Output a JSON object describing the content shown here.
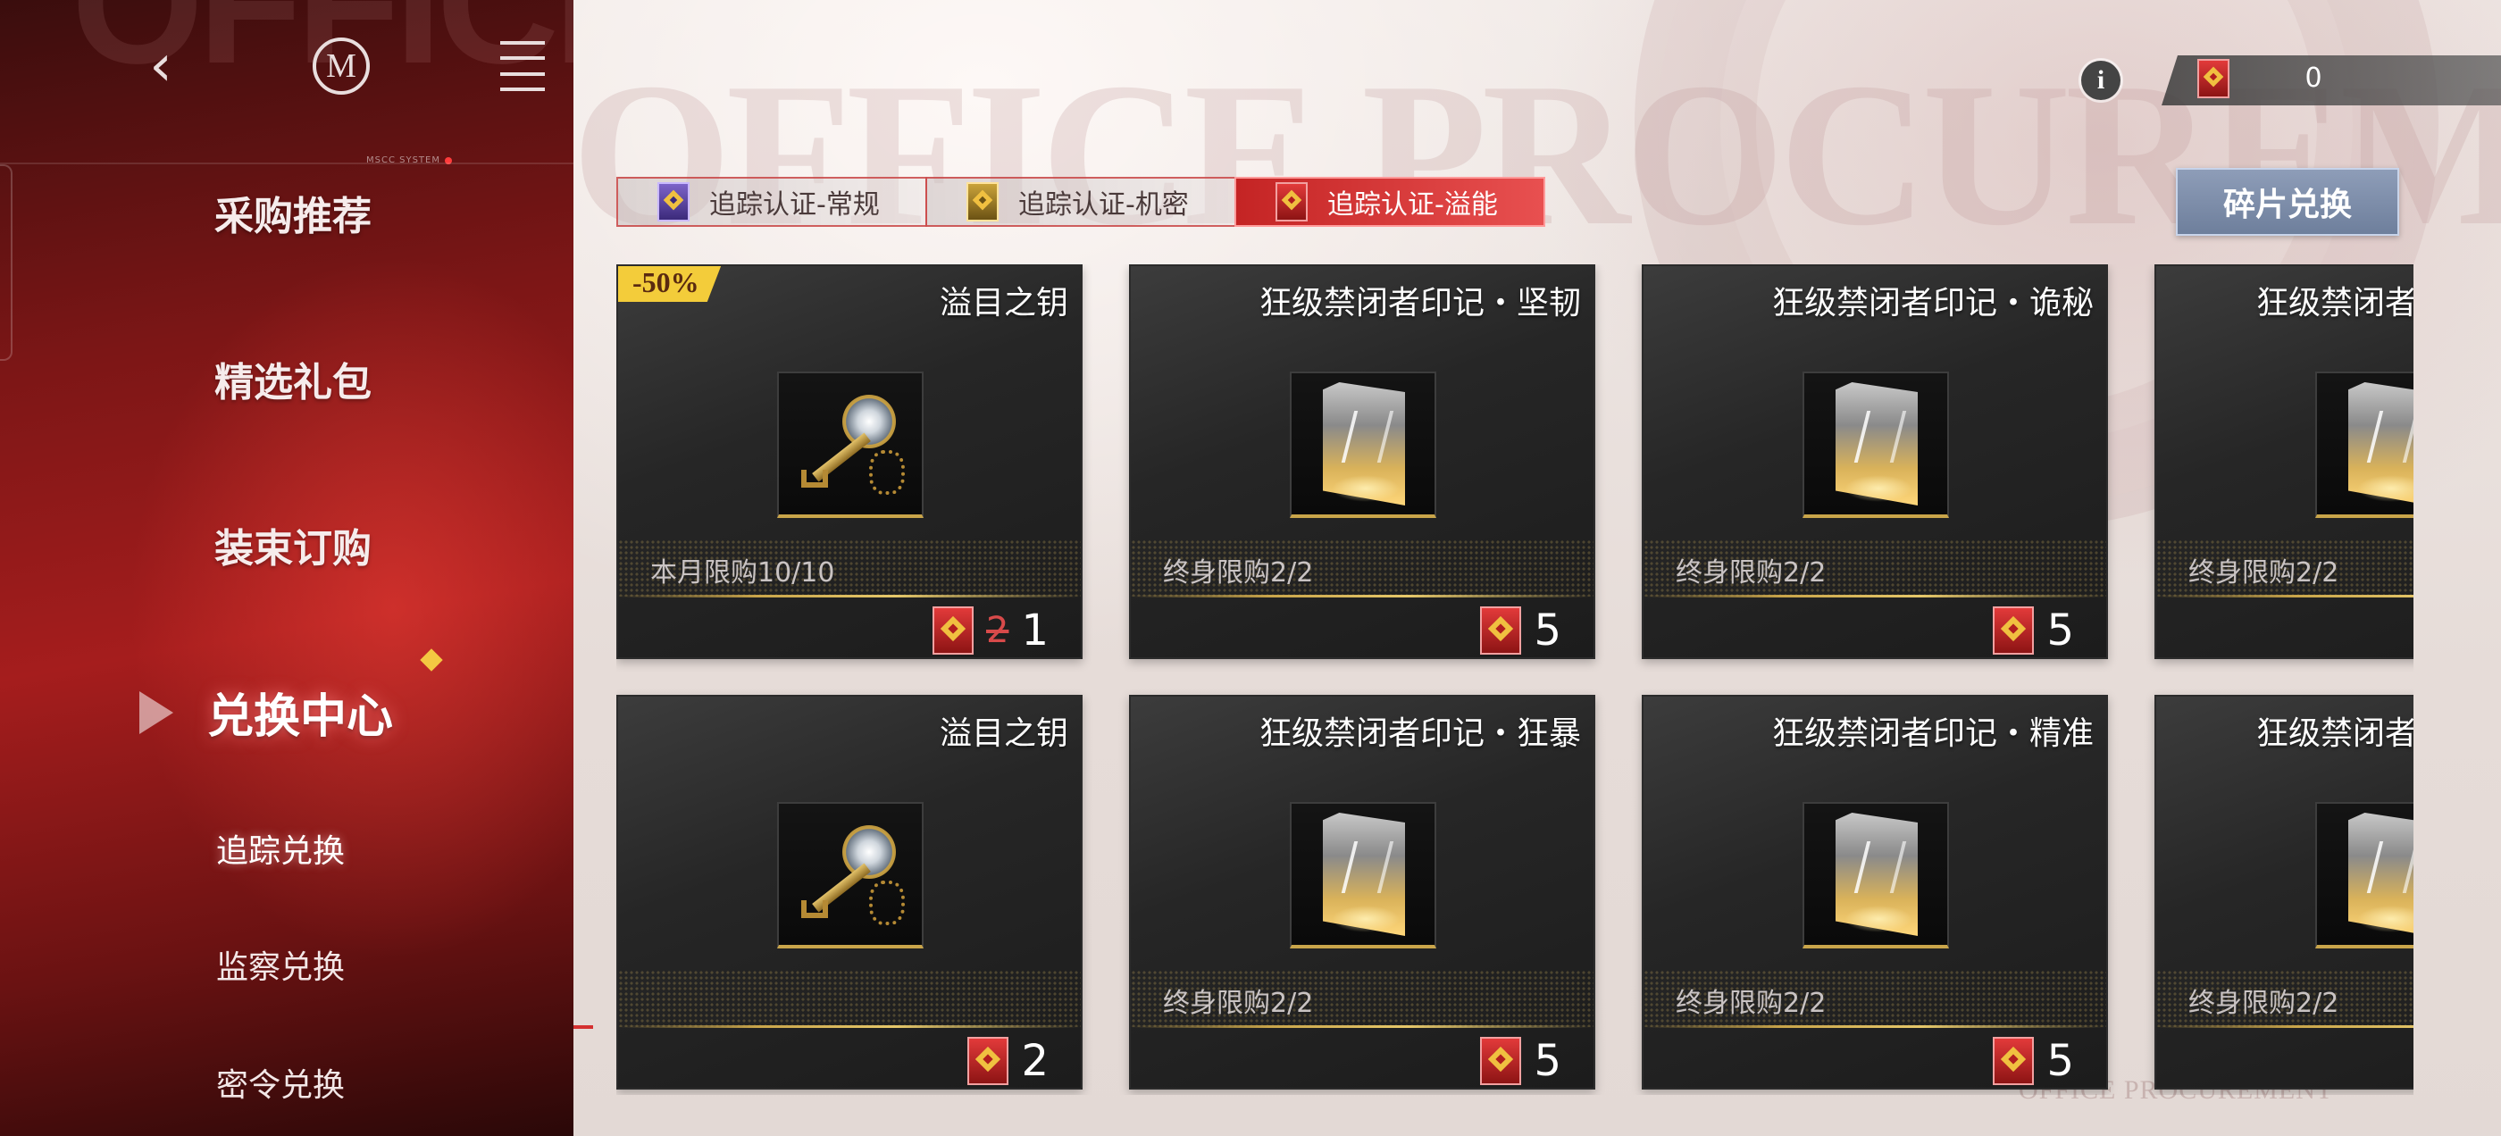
{
  "background": {
    "watermark": "OFFICE PROCUREMENT",
    "stamp": "OFFICE PROCUREMENT"
  },
  "sidebar": {
    "watermark": "OFFICE PROCUREMENT",
    "system_label": "MSCC SYSTEM",
    "logo_letter": "M",
    "back_icon": "chevron-left-icon",
    "menu_icon": "menu-icon",
    "nav_items": [
      {
        "label": "采购推荐"
      },
      {
        "label": "精选礼包"
      },
      {
        "label": "装束订购"
      },
      {
        "label": "兑换中心",
        "active": true
      }
    ],
    "sub_items": [
      {
        "label": "追踪兑换",
        "active": true
      },
      {
        "label": "监察兑换"
      },
      {
        "label": "密令兑换"
      }
    ]
  },
  "currency": {
    "info_icon": "i",
    "value": "0",
    "icon": "red-certificate-icon"
  },
  "tabs": [
    {
      "label": "追踪认证-常规",
      "icon": "purple-certificate-icon"
    },
    {
      "label": "追踪认证-机密",
      "icon": "gold-certificate-icon"
    },
    {
      "label": "追踪认证-溢能",
      "icon": "red-certificate-icon",
      "active": true
    }
  ],
  "exchange_button": "碎片兑换",
  "colors": {
    "accent_red": "#c42424",
    "discount_yellow": "#f3cc3a",
    "old_price_red": "#d84a4a"
  },
  "cards": [
    {
      "title": "溢目之钥",
      "limit": "本月限购10/10",
      "price": "1",
      "old_price": "2",
      "discount": "-50%",
      "item": "key"
    },
    {
      "title": "狂级禁闭者印记・坚韧",
      "limit": "终身限购2/2",
      "price": "5",
      "item": "shard"
    },
    {
      "title": "狂级禁闭者印记・诡秘",
      "limit": "终身限购2/2",
      "price": "5",
      "item": "shard"
    },
    {
      "title": "狂级禁闭者",
      "limit": "终身限购2/2",
      "price": "",
      "item": "shard"
    },
    {
      "title": "溢目之钥",
      "limit": "",
      "price": "2",
      "item": "key"
    },
    {
      "title": "狂级禁闭者印记・狂暴",
      "limit": "终身限购2/2",
      "price": "5",
      "item": "shard"
    },
    {
      "title": "狂级禁闭者印记・精准",
      "limit": "终身限购2/2",
      "price": "5",
      "item": "shard"
    },
    {
      "title": "狂级禁闭者",
      "limit": "终身限购2/2",
      "price": "",
      "item": "shard"
    }
  ]
}
